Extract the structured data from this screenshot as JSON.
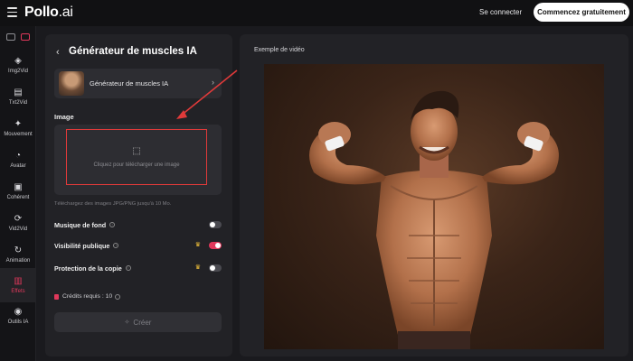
{
  "topbar": {
    "logo_main": "Pollo",
    "logo_suffix": ".ai",
    "login_label": "Se connecter",
    "start_label": "Commencez gratuitement"
  },
  "sidebar": {
    "items": [
      {
        "label": "Img2Vid",
        "icon": "img2vid-icon"
      },
      {
        "label": "Txt2Vid",
        "icon": "txt2vid-icon"
      },
      {
        "label": "Mouvement",
        "icon": "motion-icon"
      },
      {
        "label": "Avatar",
        "icon": "avatar-icon"
      },
      {
        "label": "Cohérent",
        "icon": "consistent-icon"
      },
      {
        "label": "Vid2Vid",
        "icon": "vid2vid-icon"
      },
      {
        "label": "Animation",
        "icon": "animation-icon"
      },
      {
        "label": "Effets",
        "icon": "effects-icon",
        "active": true
      },
      {
        "label": "Outils IA",
        "icon": "ai-tools-icon"
      }
    ]
  },
  "panel": {
    "back_glyph": "‹",
    "title": "Générateur de muscles IA",
    "generator_name": "Générateur de muscles IA",
    "image_label": "Image",
    "upload_text": "Cliquez pour télécharger une image",
    "upload_hint": "Téléchargez des images JPG/PNG jusqu'à 10 Mo.",
    "options": {
      "music": {
        "label": "Musique de fond",
        "on": false
      },
      "public": {
        "label": "Visibilité publique",
        "on": true
      },
      "protect": {
        "label": "Protection de la copie",
        "on": false
      }
    },
    "credits_label": "Crédits requis : 10",
    "create_label": "Créer"
  },
  "preview": {
    "label": "Exemple de vidéo"
  },
  "colors": {
    "accent": "#e0385b",
    "annotation": "#e03a3a"
  }
}
